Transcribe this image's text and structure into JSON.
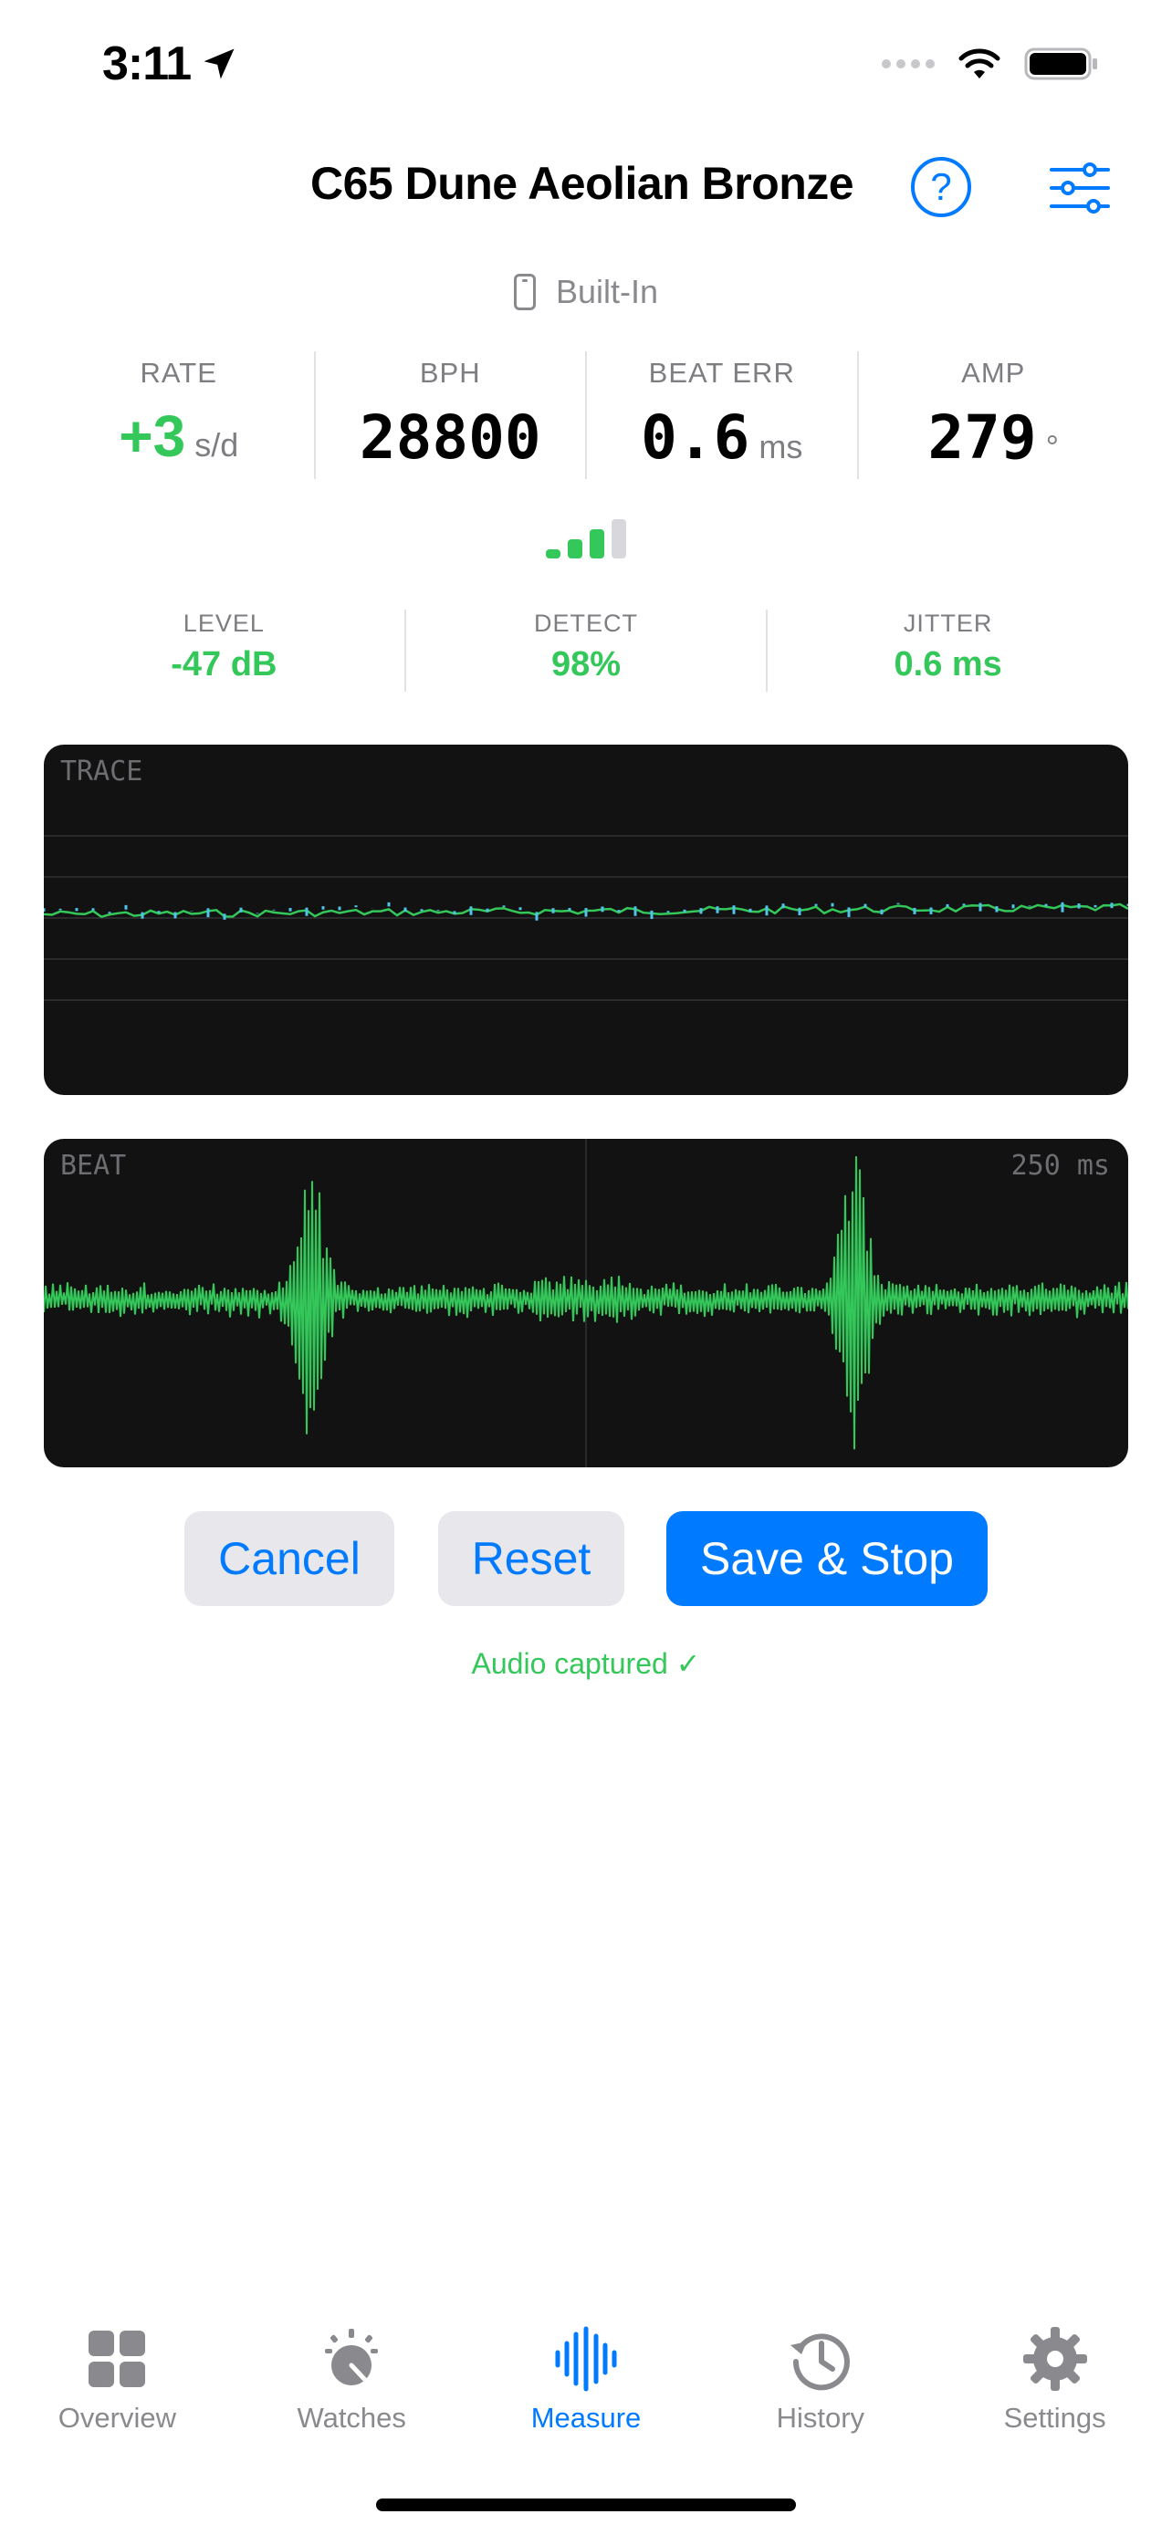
{
  "status": {
    "time": "3:11"
  },
  "header": {
    "title": "C65 Dune Aeolian Bronze",
    "help_symbol": "?"
  },
  "source": {
    "label": "Built-In"
  },
  "metrics": [
    {
      "label": "RATE",
      "value": "+3",
      "unit": "s/d"
    },
    {
      "label": "BPH",
      "value": "28800",
      "unit": ""
    },
    {
      "label": "BEAT ERR",
      "value": "0.6",
      "unit": "ms"
    },
    {
      "label": "AMP",
      "value": "279",
      "unit": "°"
    }
  ],
  "signal_strength": {
    "bars_filled": 3,
    "bars_total": 4
  },
  "submetrics": [
    {
      "label": "LEVEL",
      "value": "-47 dB"
    },
    {
      "label": "DETECT",
      "value": "98%"
    },
    {
      "label": "JITTER",
      "value": "0.6 ms"
    }
  ],
  "trace": {
    "label": "TRACE"
  },
  "beat": {
    "label": "BEAT",
    "window": "250 ms"
  },
  "buttons": {
    "cancel": "Cancel",
    "reset": "Reset",
    "save": "Save & Stop"
  },
  "capture_status": "Audio captured ✓",
  "tabs": [
    {
      "label": "Overview",
      "icon": "grid-icon",
      "active": false
    },
    {
      "label": "Watches",
      "icon": "timegrapher-icon",
      "active": false
    },
    {
      "label": "Measure",
      "icon": "waveform-icon",
      "active": true
    },
    {
      "label": "History",
      "icon": "history-icon",
      "active": false
    },
    {
      "label": "Settings",
      "icon": "gear-icon",
      "active": false
    }
  ],
  "colors": {
    "accent": "#007aff",
    "good": "#34c759",
    "trace_blue": "#4fc3e8",
    "panel_bg": "#121212"
  }
}
